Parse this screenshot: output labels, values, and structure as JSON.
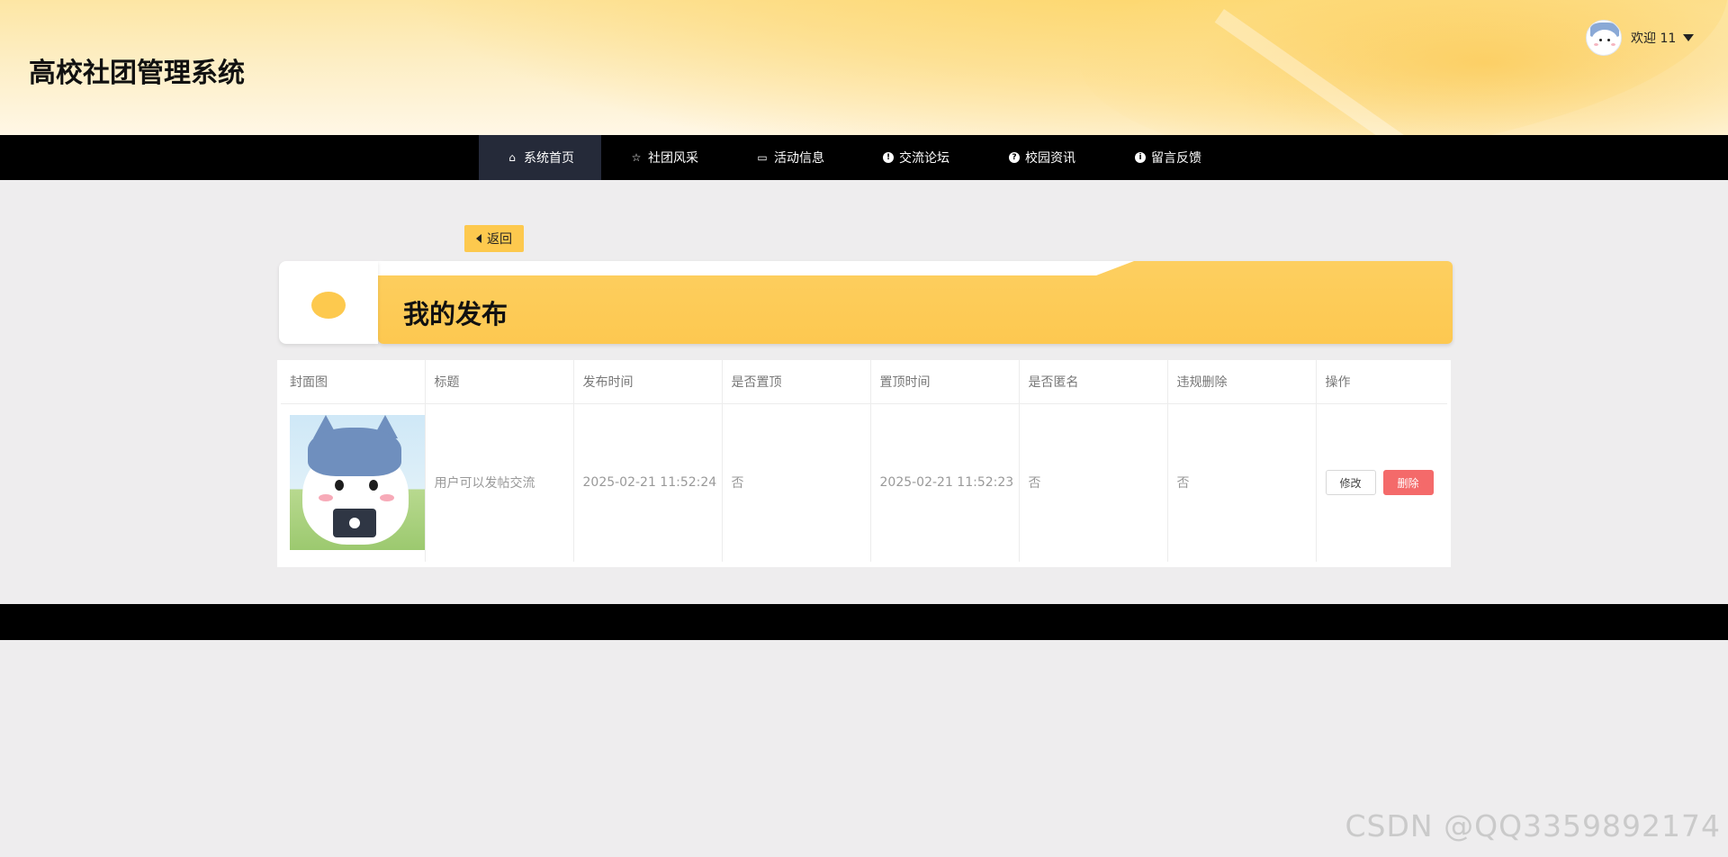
{
  "header": {
    "site_title": "高校社团管理系统",
    "welcome_text": "欢迎 11",
    "avatar_icon": "cat-avatar-icon",
    "dropdown_icon": "caret-down-icon"
  },
  "nav": {
    "items": [
      {
        "label": "系统首页",
        "icon": "home-icon",
        "glyph": "⌂",
        "active": true
      },
      {
        "label": "社团风采",
        "icon": "star-icon",
        "glyph": "☆",
        "active": false
      },
      {
        "label": "活动信息",
        "icon": "bag-icon",
        "glyph": "▭",
        "active": false
      },
      {
        "label": "交流论坛",
        "icon": "exclamation-icon",
        "glyph": "!",
        "active": false
      },
      {
        "label": "校园资讯",
        "icon": "question-icon",
        "glyph": "?",
        "active": false
      },
      {
        "label": "留言反馈",
        "icon": "info-icon",
        "glyph": "i",
        "active": false
      }
    ],
    "active_bg": "#252a39"
  },
  "back_button": {
    "label": "返回"
  },
  "section": {
    "title": "我的发布"
  },
  "table": {
    "columns": [
      "封面图",
      "标题",
      "发布时间",
      "是否置顶",
      "置顶时间",
      "是否匿名",
      "违规删除",
      "操作"
    ],
    "rows": [
      {
        "cover": "cat-camera-image",
        "title": "用户可以发帖交流",
        "publish_time": "2025-02-21 11:52:24",
        "is_top": "否",
        "top_time": "2025-02-21 11:52:23",
        "is_anonymous": "否",
        "violation_deleted": "否",
        "edit_label": "修改",
        "delete_label": "删除"
      }
    ]
  },
  "watermark": "CSDN @QQ3359892174",
  "colors": {
    "accent": "#fdc94e",
    "nav_bg": "#000000",
    "delete_btn": "#f46a6a",
    "page_bg": "#eeedee"
  }
}
